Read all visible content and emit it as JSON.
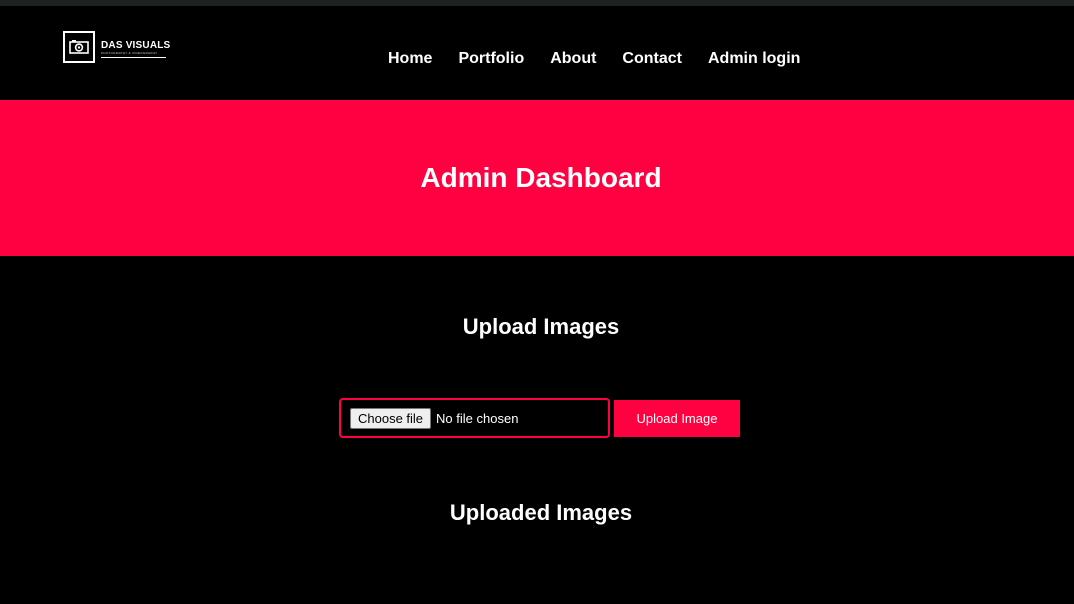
{
  "brand": {
    "name": "DAS VISUALS",
    "tagline": "PHOTOGRAPHY & VIDEOGRAPHY"
  },
  "nav": {
    "items": [
      "Home",
      "Portfolio",
      "About",
      "Contact",
      "Admin login"
    ]
  },
  "hero": {
    "title": "Admin Dashboard"
  },
  "upload": {
    "title": "Upload Images",
    "choose_label": "Choose file",
    "file_status": "No file chosen",
    "submit_label": "Upload Image"
  },
  "gallery": {
    "title": "Uploaded Images"
  },
  "colors": {
    "accent": "#ff0040",
    "background": "#000000",
    "top_strip": "#1d2320"
  }
}
